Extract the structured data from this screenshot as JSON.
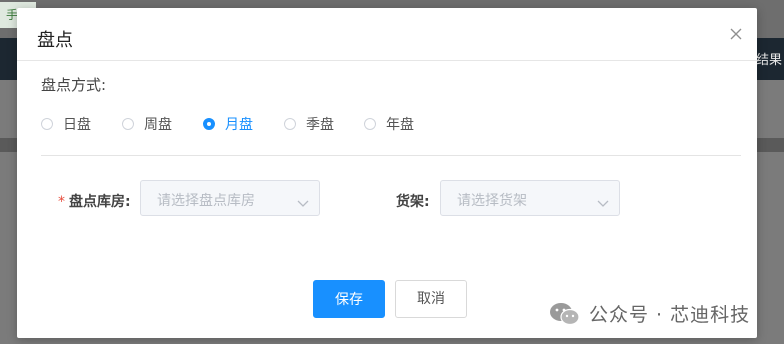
{
  "background": {
    "tag_text": "手机",
    "right_text": "结果"
  },
  "dialog": {
    "title": "盘点",
    "mode_label": "盘点方式:",
    "modes": [
      {
        "label": "日盘",
        "checked": false
      },
      {
        "label": "周盘",
        "checked": false
      },
      {
        "label": "月盘",
        "checked": true
      },
      {
        "label": "季盘",
        "checked": false
      },
      {
        "label": "年盘",
        "checked": false
      }
    ],
    "warehouse": {
      "required_mark": "*",
      "label": "盘点库房:",
      "placeholder": "请选择盘点库房"
    },
    "shelf": {
      "label": "货架:",
      "placeholder": "请选择货架"
    },
    "buttons": {
      "save": "保存",
      "cancel": "取消"
    }
  },
  "watermark": {
    "text": "公众号 · 芯迪科技",
    "icon": "wechat-icon"
  },
  "colors": {
    "accent": "#1890ff",
    "required": "#e74c3c",
    "overlay": "#7a7a7a"
  }
}
